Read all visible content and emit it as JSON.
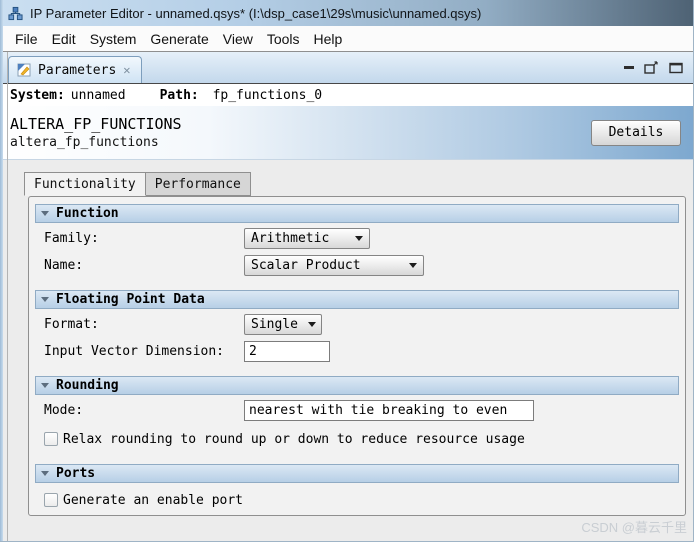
{
  "window": {
    "title": "IP Parameter Editor - unnamed.qsys* (I:\\dsp_case1\\29s\\music\\unnamed.qsys)"
  },
  "menu": {
    "items": [
      "File",
      "Edit",
      "System",
      "Generate",
      "View",
      "Tools",
      "Help"
    ]
  },
  "view_tab": {
    "label": "Parameters",
    "close_glyph": "✕"
  },
  "syspath": {
    "system_label": "System:",
    "system_value": "unnamed",
    "path_label": "Path:",
    "path_value": "fp_functions_0"
  },
  "header": {
    "title": "ALTERA_FP_FUNCTIONS",
    "subtitle": "altera_fp_functions",
    "details_label": "Details"
  },
  "doc_tabs": [
    {
      "label": "Functionality",
      "active": true
    },
    {
      "label": "Performance",
      "active": false
    }
  ],
  "sections": [
    {
      "title": "Function",
      "rows": [
        {
          "label": "Family:",
          "value": "Arithmetic",
          "control": "select"
        },
        {
          "label": "Name:",
          "value": "Scalar Product",
          "control": "select"
        }
      ]
    },
    {
      "title": "Floating Point Data",
      "rows": [
        {
          "label": "Format:",
          "value": "Single",
          "control": "select"
        },
        {
          "label": "Input Vector Dimension:",
          "value": "2",
          "control": "text"
        }
      ]
    },
    {
      "title": "Rounding",
      "rows": [
        {
          "label": "Mode:",
          "value": "nearest with tie breaking to even",
          "control": "text"
        }
      ],
      "checkbox": {
        "label": "Relax rounding to round up or down to reduce resource usage",
        "checked": false
      }
    },
    {
      "title": "Ports",
      "checkbox": {
        "label": "Generate an enable port",
        "checked": false
      }
    }
  ],
  "watermark": "CSDN @暮云千里",
  "icons": {
    "app": "qsys-network-icon",
    "tab": "parameters-wrench-icon",
    "minimize": "–",
    "float": "float-box-arrow",
    "maximize": "box-outline"
  },
  "colors": {
    "titlebar_left": "#cbdff1",
    "titlebar_right": "#4e6274",
    "header_blue": "#7da8cf",
    "section_header_blue": "#b7cfe6",
    "panel_bg": "#f2f2f2",
    "tabbar_blue": "#c3d8ec"
  }
}
